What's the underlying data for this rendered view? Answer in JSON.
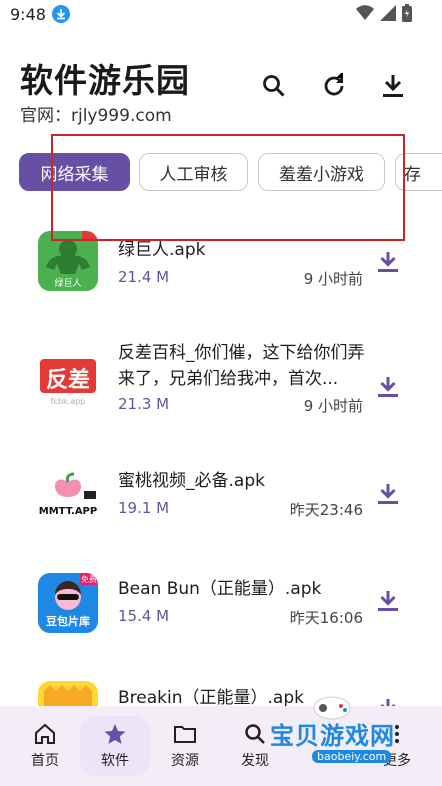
{
  "status": {
    "time": "9:48"
  },
  "header": {
    "title": "软件游乐园",
    "subtitle": "官网：rjly999.com"
  },
  "tabs": [
    {
      "label": "网络采集",
      "active": true
    },
    {
      "label": "人工审核",
      "active": false
    },
    {
      "label": "羞羞小游戏",
      "active": false
    },
    {
      "label": "存",
      "active": false
    }
  ],
  "items": [
    {
      "name": "绿巨人.apk",
      "size": "21.4 M",
      "time": "9 小时前",
      "icon_text": "绿巨人",
      "badge": ""
    },
    {
      "name": "反差百科_你们催，这下给你们弄来了，兄弟们给我冲，首次...",
      "size": "21.3 M",
      "time": "9 小时前",
      "icon_text": "反差",
      "icon_sub": "fcbk.app"
    },
    {
      "name": "蜜桃视频_必备.apk",
      "size": "19.1 M",
      "time": "昨天23:46",
      "icon_text": "MMTT.APP"
    },
    {
      "name": "Bean Bun（正能量）.apk",
      "size": "15.4 M",
      "time": "昨天16:06",
      "icon_text": "豆包片库",
      "badge": "免费"
    },
    {
      "name": "Breakin（正能量）.apk",
      "size": "",
      "time": ""
    }
  ],
  "nav": [
    {
      "label": "首页",
      "icon": "home-icon"
    },
    {
      "label": "软件",
      "icon": "star-icon"
    },
    {
      "label": "资源",
      "icon": "folder-icon"
    },
    {
      "label": "发现",
      "icon": "search-icon"
    },
    {
      "label": "更多",
      "icon": "more-icon"
    }
  ],
  "watermark": {
    "text": "宝贝游戏网",
    "sub": "baobeiy.com"
  },
  "colors": {
    "accent": "#6750a4",
    "nav_bg": "#f3edf7",
    "annotation": "#c62828"
  }
}
